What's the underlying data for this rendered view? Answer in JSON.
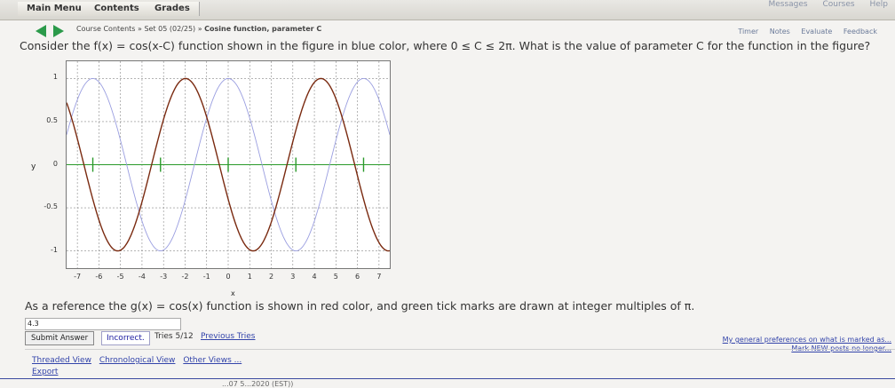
{
  "topbar": {
    "tabs": [
      "Main Menu",
      "Contents",
      "Grades"
    ],
    "links": [
      "Messages",
      "Courses",
      "Help"
    ]
  },
  "breadcrumb": {
    "course_contents": "Course Contents",
    "set": "Set 05 (02/25)",
    "problem": "Cosine function, parameter C",
    "sep": "»"
  },
  "tools": [
    "Timer",
    "Notes",
    "Evaluate",
    "Feedback"
  ],
  "question": "Consider the f(x) = cos(x-C) function shown in the figure in blue color, where 0 ≤ C ≤ 2π. What is the value of parameter C for the function in the figure?",
  "reference": "As a reference the g(x) = cos(x) function is shown in red color, and green tick marks are drawn at integer multiples of π.",
  "answer": {
    "value": "4.3"
  },
  "submit_label": "Submit Answer",
  "status": "Incorrect.",
  "tries": "Tries 5/12",
  "previous_tries": "Previous Tries",
  "prefs": [
    "My general preferences on what is marked as...",
    "Mark NEW posts no longer..."
  ],
  "footer": {
    "threaded": "Threaded View",
    "chronological": "Chronological View",
    "other": "Other Views ...",
    "export": "Export"
  },
  "timestamp": "...07 5...2020 (EST))",
  "chart_data": {
    "type": "line",
    "xlabel": "x",
    "ylabel": "y",
    "xlim": [
      -7.5,
      7.5
    ],
    "ylim": [
      -1.2,
      1.2
    ],
    "x_ticks": [
      -7,
      -6,
      -5,
      -4,
      -3,
      -2,
      -1,
      0,
      1,
      2,
      3,
      4,
      5,
      6,
      7
    ],
    "y_ticks": [
      1,
      0.5,
      0,
      -0.5,
      -1
    ],
    "y_tick_labels": [
      "1",
      "0.5",
      "0",
      "-0.5",
      "-1"
    ],
    "series": [
      {
        "function": "cos(x)",
        "color": "#9a9ee0"
      },
      {
        "function": "cos(x-4.3)",
        "color": "#7a2a10"
      }
    ],
    "pi_tick_color": "#2a9a2a",
    "pi_multiples": [
      -2,
      -1,
      0,
      1,
      2
    ]
  }
}
